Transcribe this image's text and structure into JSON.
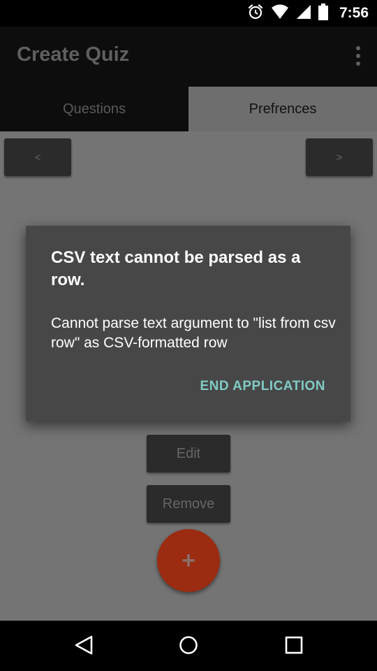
{
  "status_bar": {
    "time": "7:56",
    "icons": [
      "alarm-icon",
      "wifi-icon",
      "signal-icon",
      "battery-icon"
    ]
  },
  "app_bar": {
    "title": "Create Quiz",
    "menu_icon": "overflow-menu-icon"
  },
  "tabs": [
    {
      "label": "Questions",
      "selected": false
    },
    {
      "label": "Prefrences",
      "selected": true
    }
  ],
  "pager": {
    "prev_label": "<",
    "next_label": ">"
  },
  "actions": {
    "edit_label": "Edit",
    "remove_label": "Remove",
    "fab_label": "+"
  },
  "dialog": {
    "title": "CSV text cannot be parsed as a row.",
    "message": "Cannot parse text argument to \"list from csv row\" as CSV-formatted row",
    "action_label": "END APPLICATION"
  },
  "nav_bar": {
    "icons": [
      "back-icon",
      "home-icon",
      "recents-icon"
    ]
  },
  "colors": {
    "dialog_bg": "#474747",
    "dialog_action": "#80cbc4",
    "fab": "#9b2b11",
    "scrim_content": "#747474"
  }
}
